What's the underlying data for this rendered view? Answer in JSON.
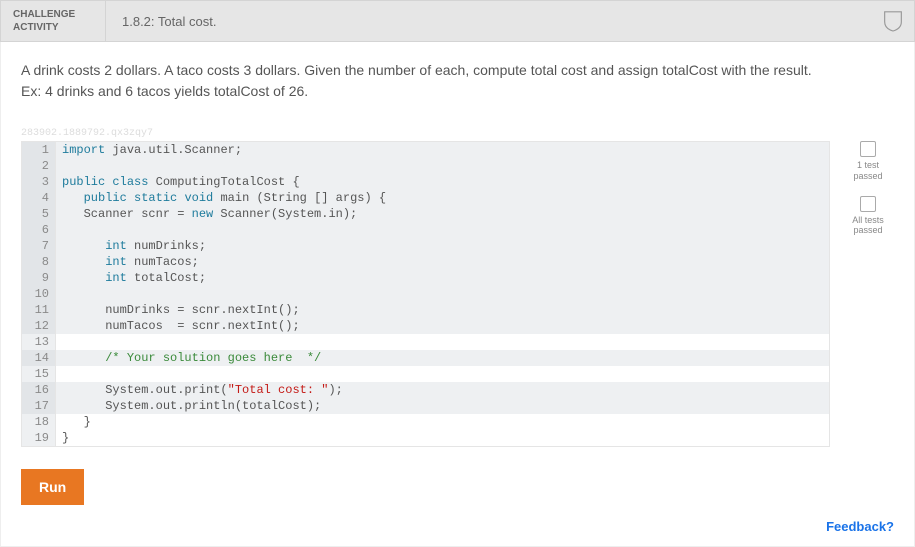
{
  "header": {
    "label_line1": "CHALLENGE",
    "label_line2": "ACTIVITY",
    "title": "1.8.2: Total cost."
  },
  "prompt": {
    "line1": "A drink costs 2 dollars. A taco costs 3 dollars. Given the number of each, compute total cost and assign totalCost with the result.",
    "line2": "Ex: 4 drinks and 6 tacos yields totalCost of 26."
  },
  "watermark": "283902.1889792.qx3zqy7",
  "code": {
    "lines": [
      {
        "n": "1",
        "highlight": true,
        "tokens": [
          {
            "t": "kw",
            "v": "import"
          },
          {
            "t": "p",
            "v": " java.util.Scanner;"
          }
        ]
      },
      {
        "n": "2",
        "highlight": true,
        "tokens": []
      },
      {
        "n": "3",
        "highlight": true,
        "tokens": [
          {
            "t": "kw",
            "v": "public"
          },
          {
            "t": "p",
            "v": " "
          },
          {
            "t": "kw",
            "v": "class"
          },
          {
            "t": "p",
            "v": " ComputingTotalCost {"
          }
        ]
      },
      {
        "n": "4",
        "highlight": true,
        "tokens": [
          {
            "t": "p",
            "v": "   "
          },
          {
            "t": "kw",
            "v": "public"
          },
          {
            "t": "p",
            "v": " "
          },
          {
            "t": "kw",
            "v": "static"
          },
          {
            "t": "p",
            "v": " "
          },
          {
            "t": "kw",
            "v": "void"
          },
          {
            "t": "p",
            "v": " main (String [] args) {"
          }
        ]
      },
      {
        "n": "5",
        "highlight": true,
        "tokens": [
          {
            "t": "p",
            "v": "   Scanner scnr = "
          },
          {
            "t": "kw",
            "v": "new"
          },
          {
            "t": "p",
            "v": " Scanner(System.in);"
          }
        ]
      },
      {
        "n": "6",
        "highlight": true,
        "tokens": []
      },
      {
        "n": "7",
        "highlight": true,
        "tokens": [
          {
            "t": "p",
            "v": "      "
          },
          {
            "t": "kw",
            "v": "int"
          },
          {
            "t": "p",
            "v": " numDrinks;"
          }
        ]
      },
      {
        "n": "8",
        "highlight": true,
        "tokens": [
          {
            "t": "p",
            "v": "      "
          },
          {
            "t": "kw",
            "v": "int"
          },
          {
            "t": "p",
            "v": " numTacos;"
          }
        ]
      },
      {
        "n": "9",
        "highlight": true,
        "tokens": [
          {
            "t": "p",
            "v": "      "
          },
          {
            "t": "kw",
            "v": "int"
          },
          {
            "t": "p",
            "v": " totalCost;"
          }
        ]
      },
      {
        "n": "10",
        "highlight": true,
        "tokens": []
      },
      {
        "n": "11",
        "highlight": true,
        "tokens": [
          {
            "t": "p",
            "v": "      numDrinks = scnr.nextInt();"
          }
        ]
      },
      {
        "n": "12",
        "highlight": true,
        "tokens": [
          {
            "t": "p",
            "v": "      numTacos  = scnr.nextInt();"
          }
        ]
      },
      {
        "n": "13",
        "highlight": false,
        "tokens": []
      },
      {
        "n": "14",
        "highlight": true,
        "tokens": [
          {
            "t": "p",
            "v": "      "
          },
          {
            "t": "cm",
            "v": "/* Your solution goes here  */"
          }
        ]
      },
      {
        "n": "15",
        "highlight": false,
        "tokens": []
      },
      {
        "n": "16",
        "highlight": true,
        "tokens": [
          {
            "t": "p",
            "v": "      System.out.print("
          },
          {
            "t": "str",
            "v": "\"Total cost: \""
          },
          {
            "t": "p",
            "v": ");"
          }
        ]
      },
      {
        "n": "17",
        "highlight": true,
        "tokens": [
          {
            "t": "p",
            "v": "      System.out.println(totalCost);"
          }
        ]
      },
      {
        "n": "18",
        "highlight": false,
        "tokens": [
          {
            "t": "p",
            "v": "   }"
          }
        ]
      },
      {
        "n": "19",
        "highlight": false,
        "tokens": [
          {
            "t": "p",
            "v": "}"
          }
        ]
      }
    ]
  },
  "status": {
    "one_test": "1 test\npassed",
    "all_tests": "All tests\npassed"
  },
  "buttons": {
    "run": "Run"
  },
  "feedback": "Feedback?"
}
